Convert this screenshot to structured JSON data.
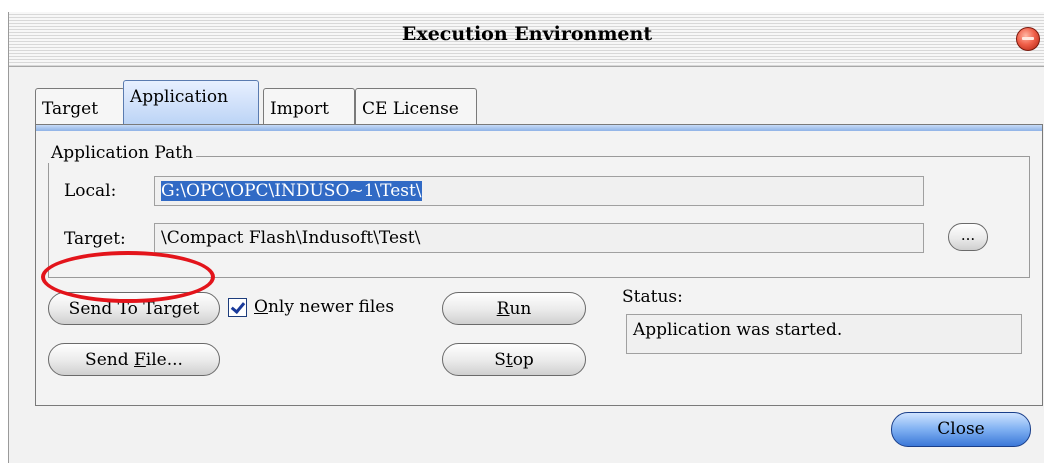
{
  "window": {
    "title": "Execution Environment"
  },
  "tabs": [
    {
      "label": "Target"
    },
    {
      "label": "Application"
    },
    {
      "label": "Import"
    },
    {
      "label": "CE License"
    }
  ],
  "application_path": {
    "group_label": "Application Path",
    "local_label": "Local:",
    "local_value": "G:\\OPC\\OPC\\INDUSO~1\\Test\\",
    "target_label": "Target:",
    "target_value": "\\Compact Flash\\Indusoft\\Test\\",
    "browse_label": "..."
  },
  "actions": {
    "send_to_target": "Send To Target",
    "only_newer_files": {
      "label": "Only newer files",
      "checked": true
    },
    "run": "Run",
    "stop": "Stop",
    "send_file": "Send File...",
    "close": "Close"
  },
  "status": {
    "label": "Status:",
    "value": "Application was started."
  },
  "colors": {
    "highlight_ellipse": "#e3141b",
    "selection": "#316ac5"
  }
}
